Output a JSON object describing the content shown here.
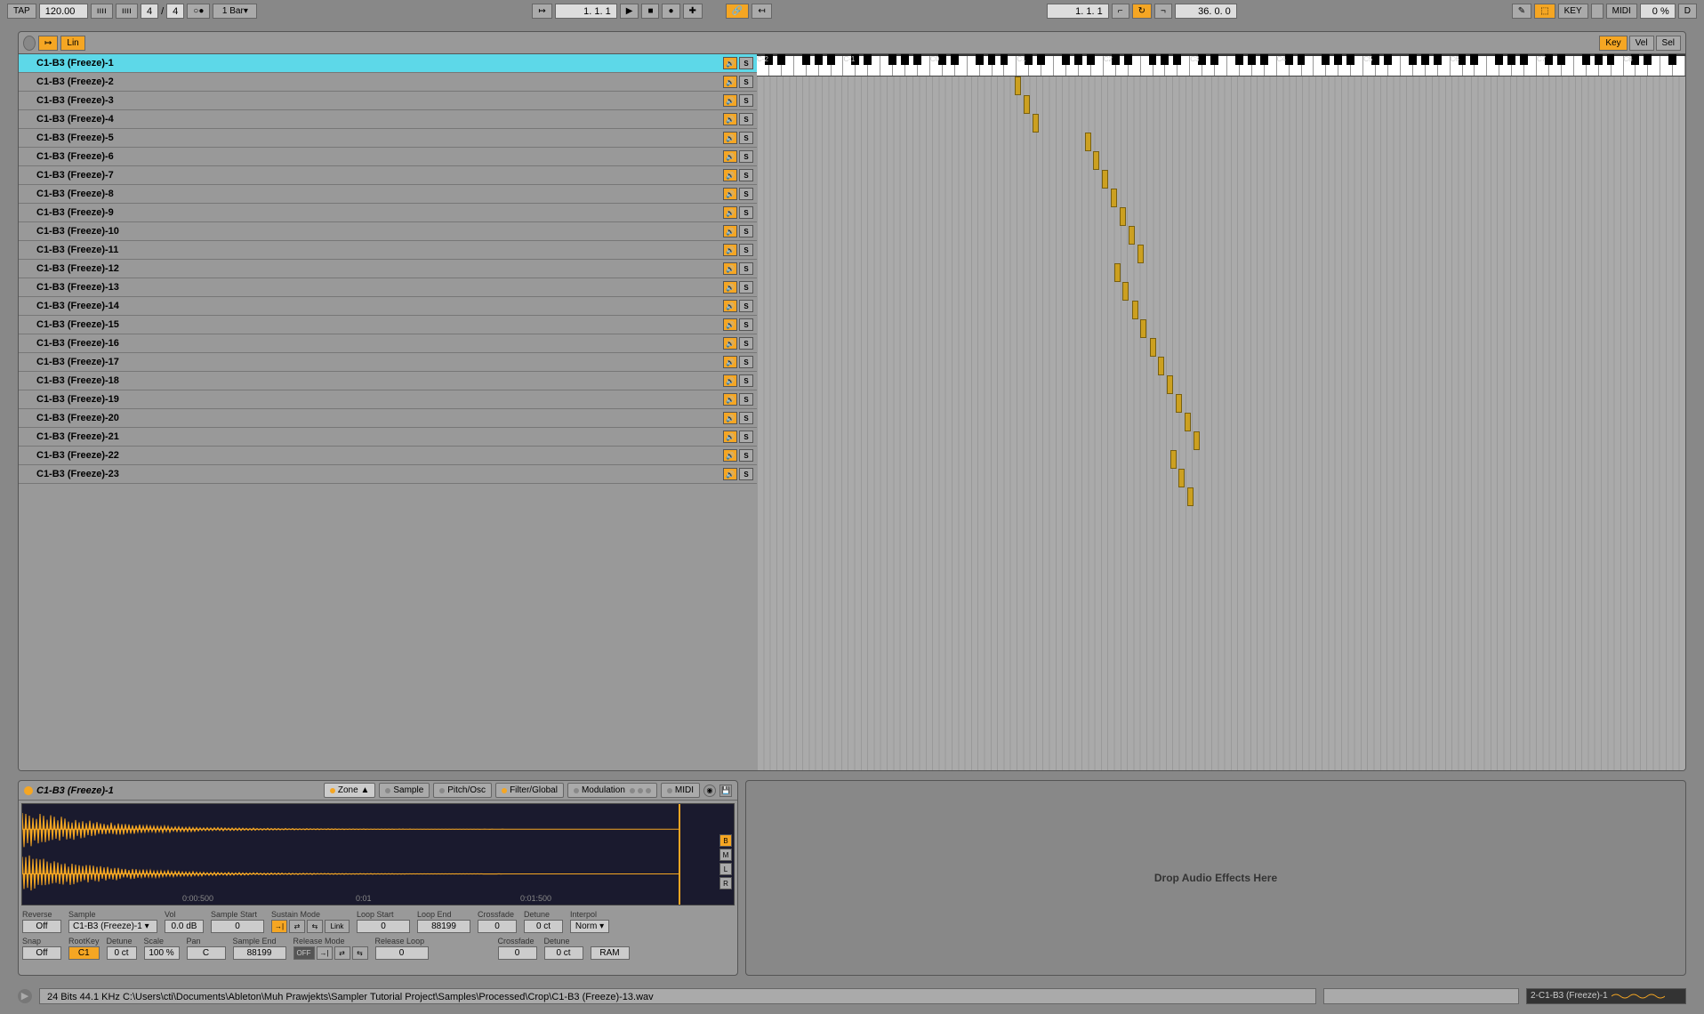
{
  "topbar": {
    "tap": "TAP",
    "tempo": "120.00",
    "sig_num": "4",
    "sig_sep": "/",
    "sig_den": "4",
    "quantize": "1 Bar",
    "position": "1.  1.  1",
    "arr_position": "1.  1.  1",
    "loop_len": "36.  0.  0",
    "key_btn": "KEY",
    "midi_btn": "MIDI",
    "cpu": "0 %",
    "d_btn": "D"
  },
  "zone_header": {
    "lin": "Lin",
    "key": "Key",
    "vel": "Vel",
    "sel": "Sel"
  },
  "octaves": [
    "C-2",
    "C-1",
    "C0",
    "C1",
    "C2",
    "C3",
    "C4",
    "C5",
    "C6",
    "C7",
    "C8"
  ],
  "samples": [
    {
      "name": "C1-B3 (Freeze)-1",
      "selected": true,
      "keypos": 27.8
    },
    {
      "name": "C1-B3 (Freeze)-2",
      "keypos": 28.7
    },
    {
      "name": "C1-B3 (Freeze)-3",
      "keypos": 29.7
    },
    {
      "name": "C1-B3 (Freeze)-4",
      "keypos": 35.3
    },
    {
      "name": "C1-B3 (Freeze)-5",
      "keypos": 36.2
    },
    {
      "name": "C1-B3 (Freeze)-6",
      "keypos": 37.2
    },
    {
      "name": "C1-B3 (Freeze)-7",
      "keypos": 38.1
    },
    {
      "name": "C1-B3 (Freeze)-8",
      "keypos": 39.1
    },
    {
      "name": "C1-B3 (Freeze)-9",
      "keypos": 40.0
    },
    {
      "name": "C1-B3 (Freeze)-10",
      "keypos": 41.0
    },
    {
      "name": "C1-B3 (Freeze)-11",
      "keypos": 38.5
    },
    {
      "name": "C1-B3 (Freeze)-12",
      "keypos": 39.4
    },
    {
      "name": "C1-B3 (Freeze)-13",
      "keypos": 40.4
    },
    {
      "name": "C1-B3 (Freeze)-14",
      "keypos": 41.3
    },
    {
      "name": "C1-B3 (Freeze)-15",
      "keypos": 42.3
    },
    {
      "name": "C1-B3 (Freeze)-16",
      "keypos": 43.2
    },
    {
      "name": "C1-B3 (Freeze)-17",
      "keypos": 44.2
    },
    {
      "name": "C1-B3 (Freeze)-18",
      "keypos": 45.1
    },
    {
      "name": "C1-B3 (Freeze)-19",
      "keypos": 46.1
    },
    {
      "name": "C1-B3 (Freeze)-20",
      "keypos": 47.0
    },
    {
      "name": "C1-B3 (Freeze)-21",
      "keypos": 44.5
    },
    {
      "name": "C1-B3 (Freeze)-22",
      "keypos": 45.4
    },
    {
      "name": "C1-B3 (Freeze)-23",
      "keypos": 46.4
    }
  ],
  "device": {
    "title": "C1-B3 (Freeze)-1",
    "tabs": {
      "zone": "Zone ▲",
      "sample": "Sample",
      "pitch": "Pitch/Osc",
      "filter": "Filter/Global",
      "modulation": "Modulation",
      "midi": "MIDI"
    },
    "wave_times": [
      "0:00:500",
      "0:01",
      "0:01:500"
    ],
    "params": {
      "reverse_lbl": "Reverse",
      "reverse_val": "Off",
      "sample_lbl": "Sample",
      "sample_val": "C1-B3 (Freeze)-1",
      "vol_lbl": "Vol",
      "vol_val": "0.0 dB",
      "sstart_lbl": "Sample Start",
      "sstart_val": "0",
      "sustain_lbl": "Sustain Mode",
      "link": "Link",
      "lstart_lbl": "Loop Start",
      "lstart_val": "0",
      "lend_lbl": "Loop End",
      "lend_val": "88199",
      "xfade_lbl": "Crossfade",
      "xfade_val": "0",
      "detune_lbl": "Detune",
      "detune_val": "0 ct",
      "interp_lbl": "Interpol",
      "interp_val": "Norm ▾",
      "snap_lbl": "Snap",
      "snap_val": "Off",
      "root_lbl": "RootKey",
      "root_val": "C1",
      "detune2_lbl": "Detune",
      "detune2_val": "0 ct",
      "scale_lbl": "Scale",
      "scale_val": "100 %",
      "pan_lbl": "Pan",
      "pan_val": "C",
      "send_lbl": "Sample End",
      "send_val": "88199",
      "release_lbl": "Release Mode",
      "off": "OFF",
      "rloop_lbl": "Release Loop",
      "rloop_val": "0",
      "xfade2_lbl": "Crossfade",
      "xfade2_val": "0",
      "detune3_lbl": "Detune",
      "detune3_val": "0 ct",
      "ram": "RAM"
    },
    "side": {
      "b": "B",
      "m": "M",
      "l": "L",
      "r": "R"
    }
  },
  "fx_drop": "Drop Audio Effects Here",
  "status": {
    "text": "24 Bits 44.1 KHz C:\\Users\\cti\\Documents\\Ableton\\Muh Prawjekts\\Sampler Tutorial Project\\Samples\\Processed\\Crop\\C1-B3 (Freeze)-13.wav",
    "clip": "2-C1-B3 (Freeze)-1"
  }
}
